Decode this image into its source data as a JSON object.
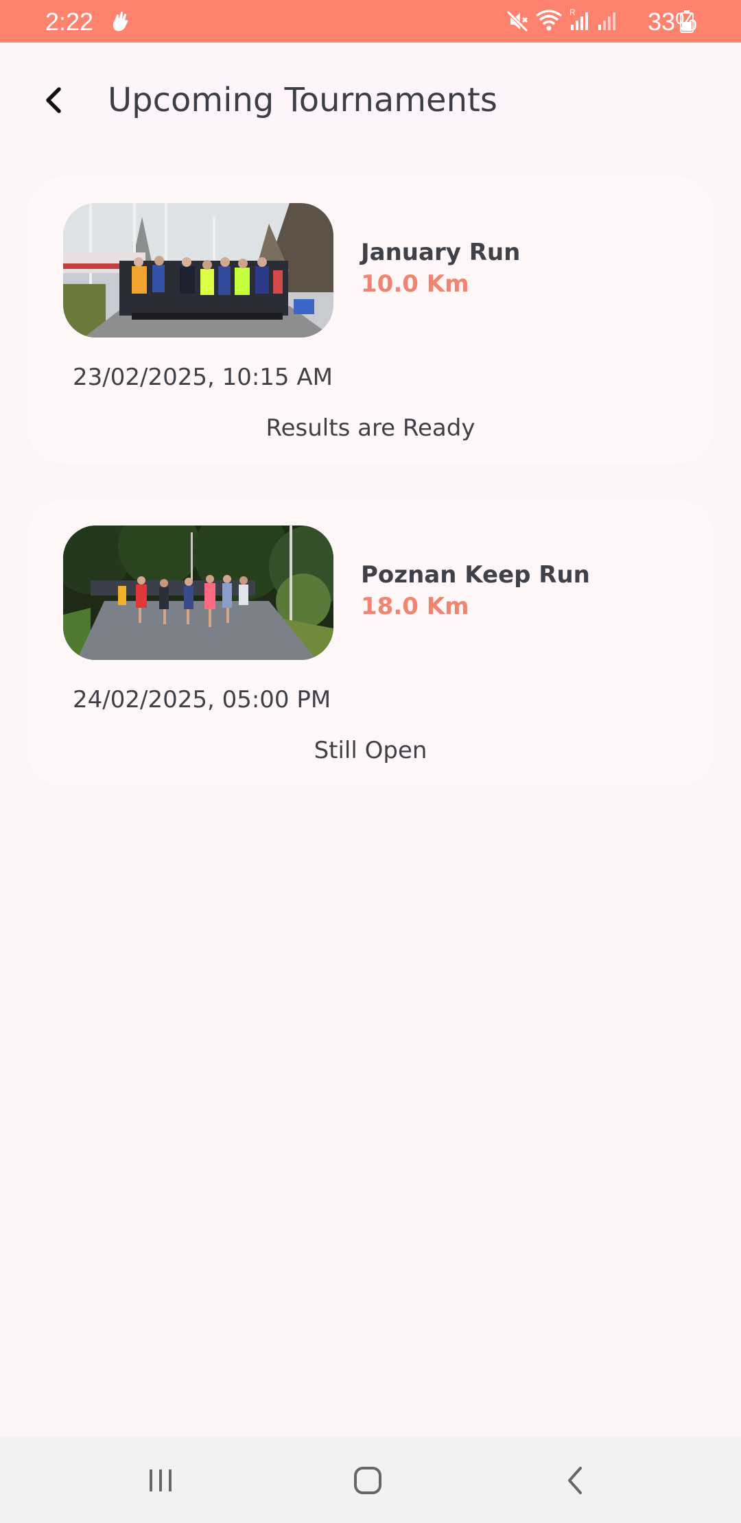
{
  "status_bar": {
    "time": "2:22",
    "battery": "33%",
    "icons": [
      "hand-icon",
      "mute-icon",
      "wifi-icon",
      "signal-roaming-icon",
      "signal-icon",
      "battery-icon"
    ],
    "color": "#ff826f"
  },
  "header": {
    "title": "Upcoming Tournaments",
    "back_icon": "chevron-left-icon"
  },
  "tournaments": [
    {
      "name": "January Run",
      "distance": "10.0 Km",
      "datetime": "23/02/2025, 10:15 AM",
      "status": "Results are Ready",
      "image": "runners-start-line-photo"
    },
    {
      "name": "Poznan Keep Run",
      "distance": "18.0 Km",
      "datetime": "24/02/2025, 05:00 PM",
      "status": "Still Open",
      "image": "runners-park-road-photo"
    }
  ],
  "nav_bar": {
    "icons": [
      "recent-apps-icon",
      "home-icon",
      "back-icon"
    ]
  },
  "colors": {
    "accent": "#ef8470",
    "background": "#fff4f7",
    "card": "#fff7f8",
    "text": "#3d3d48"
  }
}
